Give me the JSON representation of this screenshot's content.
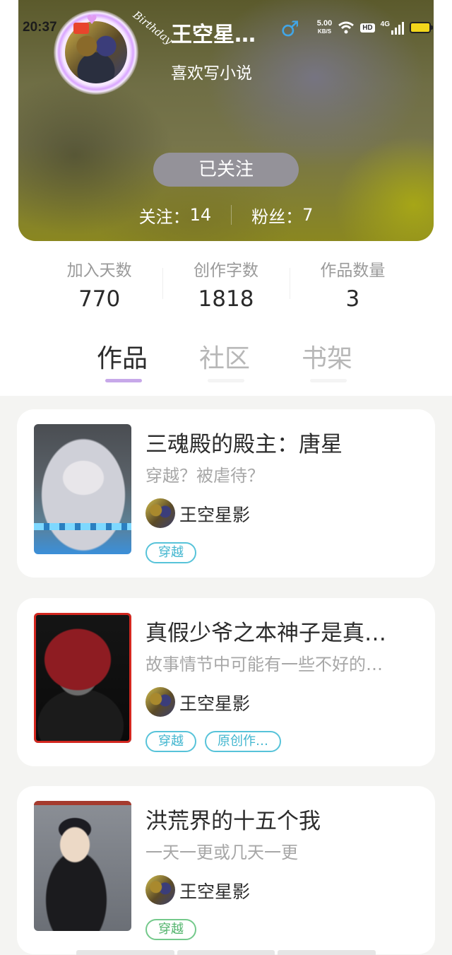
{
  "status_bar": {
    "time": "20:37",
    "net_speed_value": "5.00",
    "net_speed_unit": "KB/S",
    "hd_label": "HD",
    "signal_label": "4G"
  },
  "profile": {
    "name": "王空星…",
    "bio": "喜欢写小说",
    "gender_icon": "male-icon",
    "avatar_frame_text": "Birthday",
    "follow_button_label": "已关注",
    "following_label": "关注：",
    "following_count": "14",
    "fans_label": "粉丝：",
    "fans_count": "7"
  },
  "stats": [
    {
      "label": "加入天数",
      "value": "770"
    },
    {
      "label": "创作字数",
      "value": "1818"
    },
    {
      "label": "作品数量",
      "value": "3"
    }
  ],
  "tabs": [
    {
      "label": "作品",
      "active": true
    },
    {
      "label": "社区",
      "active": false
    },
    {
      "label": "书架",
      "active": false
    }
  ],
  "works": [
    {
      "title": "三魂殿的殿主：唐星",
      "description": "穿越？被虐待？",
      "author": "王空星影",
      "tags": [
        "穿越"
      ]
    },
    {
      "title": "真假少爷之本神子是真…",
      "description": "故事情节中可能有一些不好的…",
      "author": "王空星影",
      "tags": [
        "穿越",
        "原创作…"
      ]
    },
    {
      "title": "洪荒界的十五个我",
      "description": "一天一更或几天一更",
      "author": "王空星影",
      "tags": [
        "穿越"
      ]
    }
  ],
  "colors": {
    "tab_indicator": "#c7a8e9",
    "tag_cyan": "#42b6cf",
    "tag_green": "#53b46d",
    "gender_blue": "#41a6e8"
  }
}
